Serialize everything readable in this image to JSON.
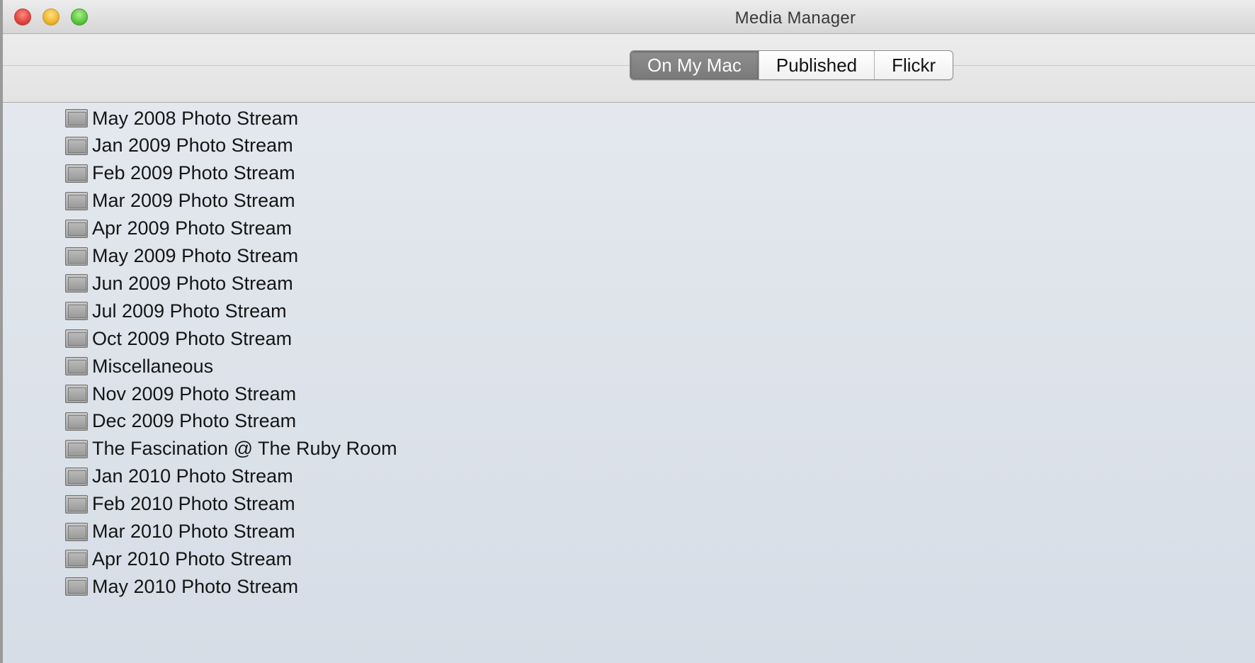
{
  "window": {
    "title": "Media Manager"
  },
  "toolbar": {
    "segments": [
      {
        "label": "On My Mac",
        "active": true
      },
      {
        "label": "Published",
        "active": false
      },
      {
        "label": "Flickr",
        "active": false
      }
    ]
  },
  "albums": [
    "May 2008 Photo Stream",
    "Jan 2009 Photo Stream",
    "Feb 2009 Photo Stream",
    "Mar 2009 Photo Stream",
    "Apr 2009 Photo Stream",
    "May 2009 Photo Stream",
    "Jun 2009 Photo Stream",
    "Jul 2009 Photo Stream",
    "Oct 2009 Photo Stream",
    "Miscellaneous",
    "Nov 2009 Photo Stream",
    "Dec 2009 Photo Stream",
    "The Fascination @ The Ruby Room",
    "Jan 2010 Photo Stream",
    "Feb 2010 Photo Stream",
    "Mar 2010 Photo Stream",
    "Apr 2010 Photo Stream",
    "May 2010 Photo Stream"
  ]
}
